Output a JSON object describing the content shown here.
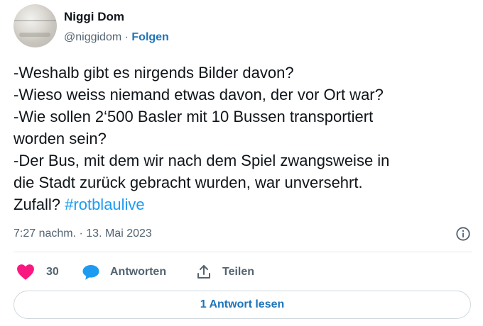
{
  "author": {
    "name": "Niggi Dom",
    "handle": "@niggidom",
    "separator": " · ",
    "follow_label": "Folgen"
  },
  "tweet": {
    "lines": [
      "-Weshalb gibt es nirgends Bilder davon?",
      "-Wieso weiss niemand etwas davon, der vor Ort war?",
      "-Wie sollen 2‘500 Basler mit 10 Bussen transportiert",
      "worden sein?",
      "-Der Bus, mit dem wir nach dem Spiel zwangsweise in",
      "die Stadt zurück gebracht wurden, war unversehrt."
    ],
    "last_line_prefix": "Zufall? ",
    "hashtag": "#rotblaulive"
  },
  "meta": {
    "timestamp": "7:27 nachm. · 13. Mai 2023",
    "info_icon": "info-icon"
  },
  "actions": {
    "likes_count": "30",
    "reply_label": "Antworten",
    "share_label": "Teilen",
    "like_icon": "heart-icon",
    "reply_icon": "speech-bubble-icon",
    "share_icon": "share-icon"
  },
  "replies_button": {
    "label": "1 Antwort lesen"
  },
  "colors": {
    "link": "#1d74b9",
    "hashtag": "#1d9bf0",
    "heart": "#f91880",
    "reply_bubble": "#1d9bf0",
    "secondary_text": "#536471",
    "border": "#cfd9de"
  }
}
